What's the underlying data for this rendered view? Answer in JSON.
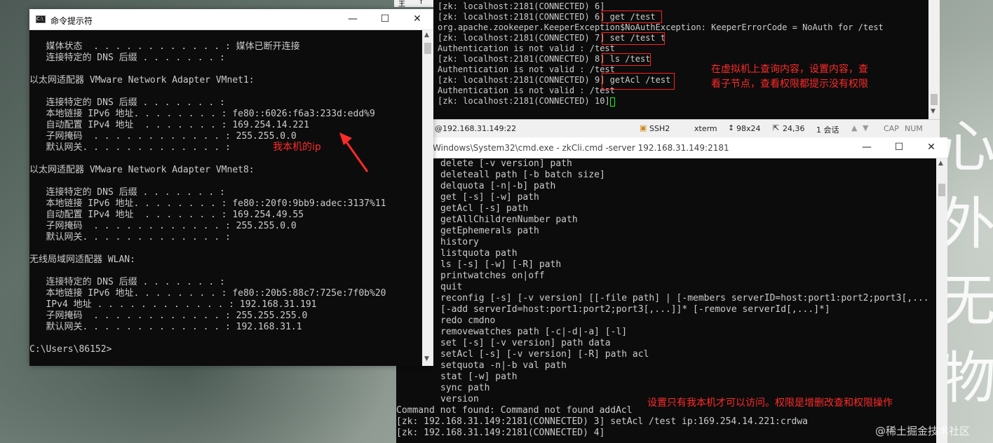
{
  "cmd_window": {
    "title": "命令提示符",
    "minimize": "—",
    "maximize": "☐",
    "close": "✕",
    "lines": [
      "",
      "   媒体状态  . . . . . . . . . . . . : 媒体已断开连接",
      "   连接特定的 DNS 后缀 . . . . . . . :",
      "",
      "以太网适配器 VMware Network Adapter VMnet1:",
      "",
      "   连接特定的 DNS 后缀 . . . . . . . :",
      "   本地链接 IPv6 地址. . . . . . . . : fe80::6026:f6a3:233d:edd%9",
      "   自动配置 IPv4 地址  . . . . . . . : 169.254.14.221",
      "   子网掩码  . . . . . . . . . . . . : 255.255.0.0",
      "   默认网关. . . . . . . . . . . . . :",
      "",
      "以太网适配器 VMware Network Adapter VMnet8:",
      "",
      "   连接特定的 DNS 后缀 . . . . . . . :",
      "   本地链接 IPv6 地址. . . . . . . . : fe80::20f0:9bb9:adec:3137%11",
      "   自动配置 IPv4 地址  . . . . . . . : 169.254.49.55",
      "   子网掩码  . . . . . . . . . . . . : 255.255.0.0",
      "   默认网关. . . . . . . . . . . . . :",
      "",
      "无线局域网适配器 WLAN:",
      "",
      "   连接特定的 DNS 后缀 . . . . . . . :",
      "   本地链接 IPv6 地址. . . . . . . . : fe80::20b5:88c7:725e:7f0b%20",
      "   IPv4 地址 . . . . . . . . . . . . : 192.168.31.191",
      "   子网掩码  . . . . . . . . . . . . : 255.255.255.0",
      "   默认网关. . . . . . . . . . . . . : 192.168.31.1",
      "",
      "C:\\Users\\86152>"
    ],
    "annotation": "我本机的ip"
  },
  "xshell": {
    "lines": [
      "[zk: localhost:2181(CONNECTED) 6]",
      "[zk: localhost:2181(CONNECTED) 6] get /test",
      "org.apache.zookeeper.KeeperException$NoAuthException: KeeperErrorCode = NoAuth for /test",
      "[zk: localhost:2181(CONNECTED) 7] set /test t",
      "Authentication is not valid : /test",
      "[zk: localhost:2181(CONNECTED) 8] ls /test",
      "Authentication is not valid : /test",
      "[zk: localhost:2181(CONNECTED) 9] getAcl /test",
      "Authentication is not valid : /test",
      "[zk: localhost:2181(CONNECTED) 10] "
    ],
    "annotation_line1": "在虚拟机上查询内容，设置内容，查",
    "annotation_line2": "看子节点，查看权限都提示没有权限",
    "status": {
      "host": "@192.168.31.149:22",
      "protocol": "SSH2",
      "term": "xterm",
      "size": "98x24",
      "pos": "24,36",
      "sessions": "1 会话",
      "caps": "CAP",
      "num": "NUM"
    },
    "topbar_left": "王",
    "topbar_right": "†"
  },
  "zkcli_window": {
    "title": "Windows\\System32\\cmd.exe - zkCli.cmd  -server 192.168.31.149:2181",
    "minimize": "—",
    "maximize": "☐",
    "close": "✕",
    "lines": [
      "delete [-v version] path",
      "deleteall path [-b batch size]",
      "delquota [-n|-b] path",
      "get [-s] [-w] path",
      "getAcl [-s] path",
      "getAllChildrenNumber path",
      "getEphemerals path",
      "history",
      "listquota path",
      "ls [-s] [-w] [-R] path",
      "printwatches on|off",
      "quit",
      "reconfig [-s] [-v version] [[-file path] | [-members serverID=host:port1:port2;port3[,...",
      "[-add serverId=host:port1:port2;port3[,...]]* [-remove serverId[,...]*]",
      "redo cmdno",
      "removewatches path [-c|-d|-a] [-l]",
      "set [-s] [-v version] path data",
      "setAcl [-s] [-v version] [-R] path acl",
      "setquota -n|-b val path",
      "stat [-w] path",
      "sync path",
      "version"
    ],
    "tail_lines": [
      "Command not found: Command not found addAcl",
      "[zk: 192.168.31.149:2181(CONNECTED) 3] setAcl /test ip:169.254.14.221:crdwa",
      "[zk: 192.168.31.149:2181(CONNECTED) 4]"
    ],
    "annotation": "设置只有我本机才可以访问。权限是增删改查和权限操作"
  },
  "desktop": {
    "chars": [
      "心",
      "外",
      "无",
      "物"
    ],
    "watermark": "@稀土掘金技术社区"
  },
  "colors": {
    "terminal_bg": "#0c0c0c",
    "terminal_text": "#cccccc",
    "annotation_red": "#ff2a2a",
    "cursor_green": "#1aff1a"
  }
}
